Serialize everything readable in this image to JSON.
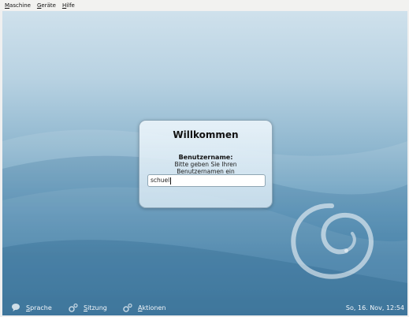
{
  "menubar": {
    "items": [
      {
        "first": "M",
        "rest": "aschine"
      },
      {
        "first": "G",
        "rest": "eräte"
      },
      {
        "first": "H",
        "rest": "ilfe"
      }
    ]
  },
  "login": {
    "title": "Willkommen",
    "username_label": "Benutzername:",
    "username_hint": "Bitte geben Sie Ihren Benutzernamen ein",
    "username_value": "schuel"
  },
  "bottom": {
    "language": {
      "first": "S",
      "rest": "prache",
      "icon": "speech-bubble-icon"
    },
    "session": {
      "first": "S",
      "rest": "itzung",
      "icon": "session-gear-icon"
    },
    "actions": {
      "first": "A",
      "rest": "ktionen",
      "icon": "actions-gear-icon"
    },
    "clock": "So, 16. Nov, 12:54"
  },
  "colors": {
    "background_top": "#cfe1ec",
    "background_bottom": "#2e6e9a",
    "bottom_text": "#f4f8fb"
  }
}
